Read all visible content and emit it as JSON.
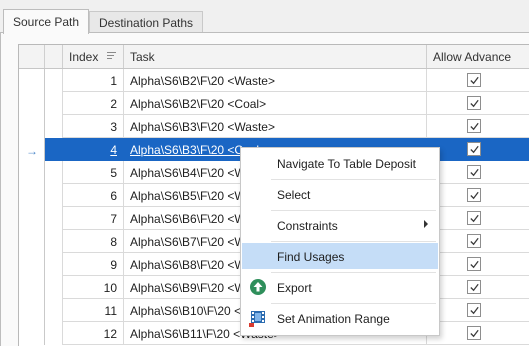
{
  "tabs": [
    {
      "label": "Source Path"
    },
    {
      "label": "Destination Paths"
    }
  ],
  "grid": {
    "columns": {
      "index": "Index",
      "task": "Task",
      "allow": "Allow Advance"
    },
    "rows": [
      {
        "index": "1",
        "task": "Alpha\\S6\\B2\\F\\20 <Waste>"
      },
      {
        "index": "2",
        "task": "Alpha\\S6\\B2\\F\\20 <Coal>"
      },
      {
        "index": "3",
        "task": "Alpha\\S6\\B3\\F\\20 <Waste>"
      },
      {
        "index": "4",
        "task": "Alpha\\S6\\B3\\F\\20 <Coal>"
      },
      {
        "index": "5",
        "task": "Alpha\\S6\\B4\\F\\20 <Wa"
      },
      {
        "index": "6",
        "task": "Alpha\\S6\\B5\\F\\20 <Wa"
      },
      {
        "index": "7",
        "task": "Alpha\\S6\\B6\\F\\20 <Wa"
      },
      {
        "index": "8",
        "task": "Alpha\\S6\\B7\\F\\20 <Wa"
      },
      {
        "index": "9",
        "task": "Alpha\\S6\\B8\\F\\20 <Wa"
      },
      {
        "index": "10",
        "task": "Alpha\\S6\\B9\\F\\20 <Wa"
      },
      {
        "index": "11",
        "task": "Alpha\\S6\\B10\\F\\20 <Wa"
      },
      {
        "index": "12",
        "task": "Alpha\\S6\\B11\\F\\20 <Waste>"
      }
    ]
  },
  "context_menu": {
    "items": [
      {
        "label": "Navigate To Table Deposit"
      },
      {
        "label": "Select"
      },
      {
        "label": "Constraints"
      },
      {
        "label": "Find Usages"
      },
      {
        "label": "Export"
      },
      {
        "label": "Set Animation Range"
      }
    ]
  },
  "colors": {
    "selection": "#1a66c4",
    "menu_highlight": "#c5ddf7",
    "export_icon": "#2f8f5b"
  }
}
